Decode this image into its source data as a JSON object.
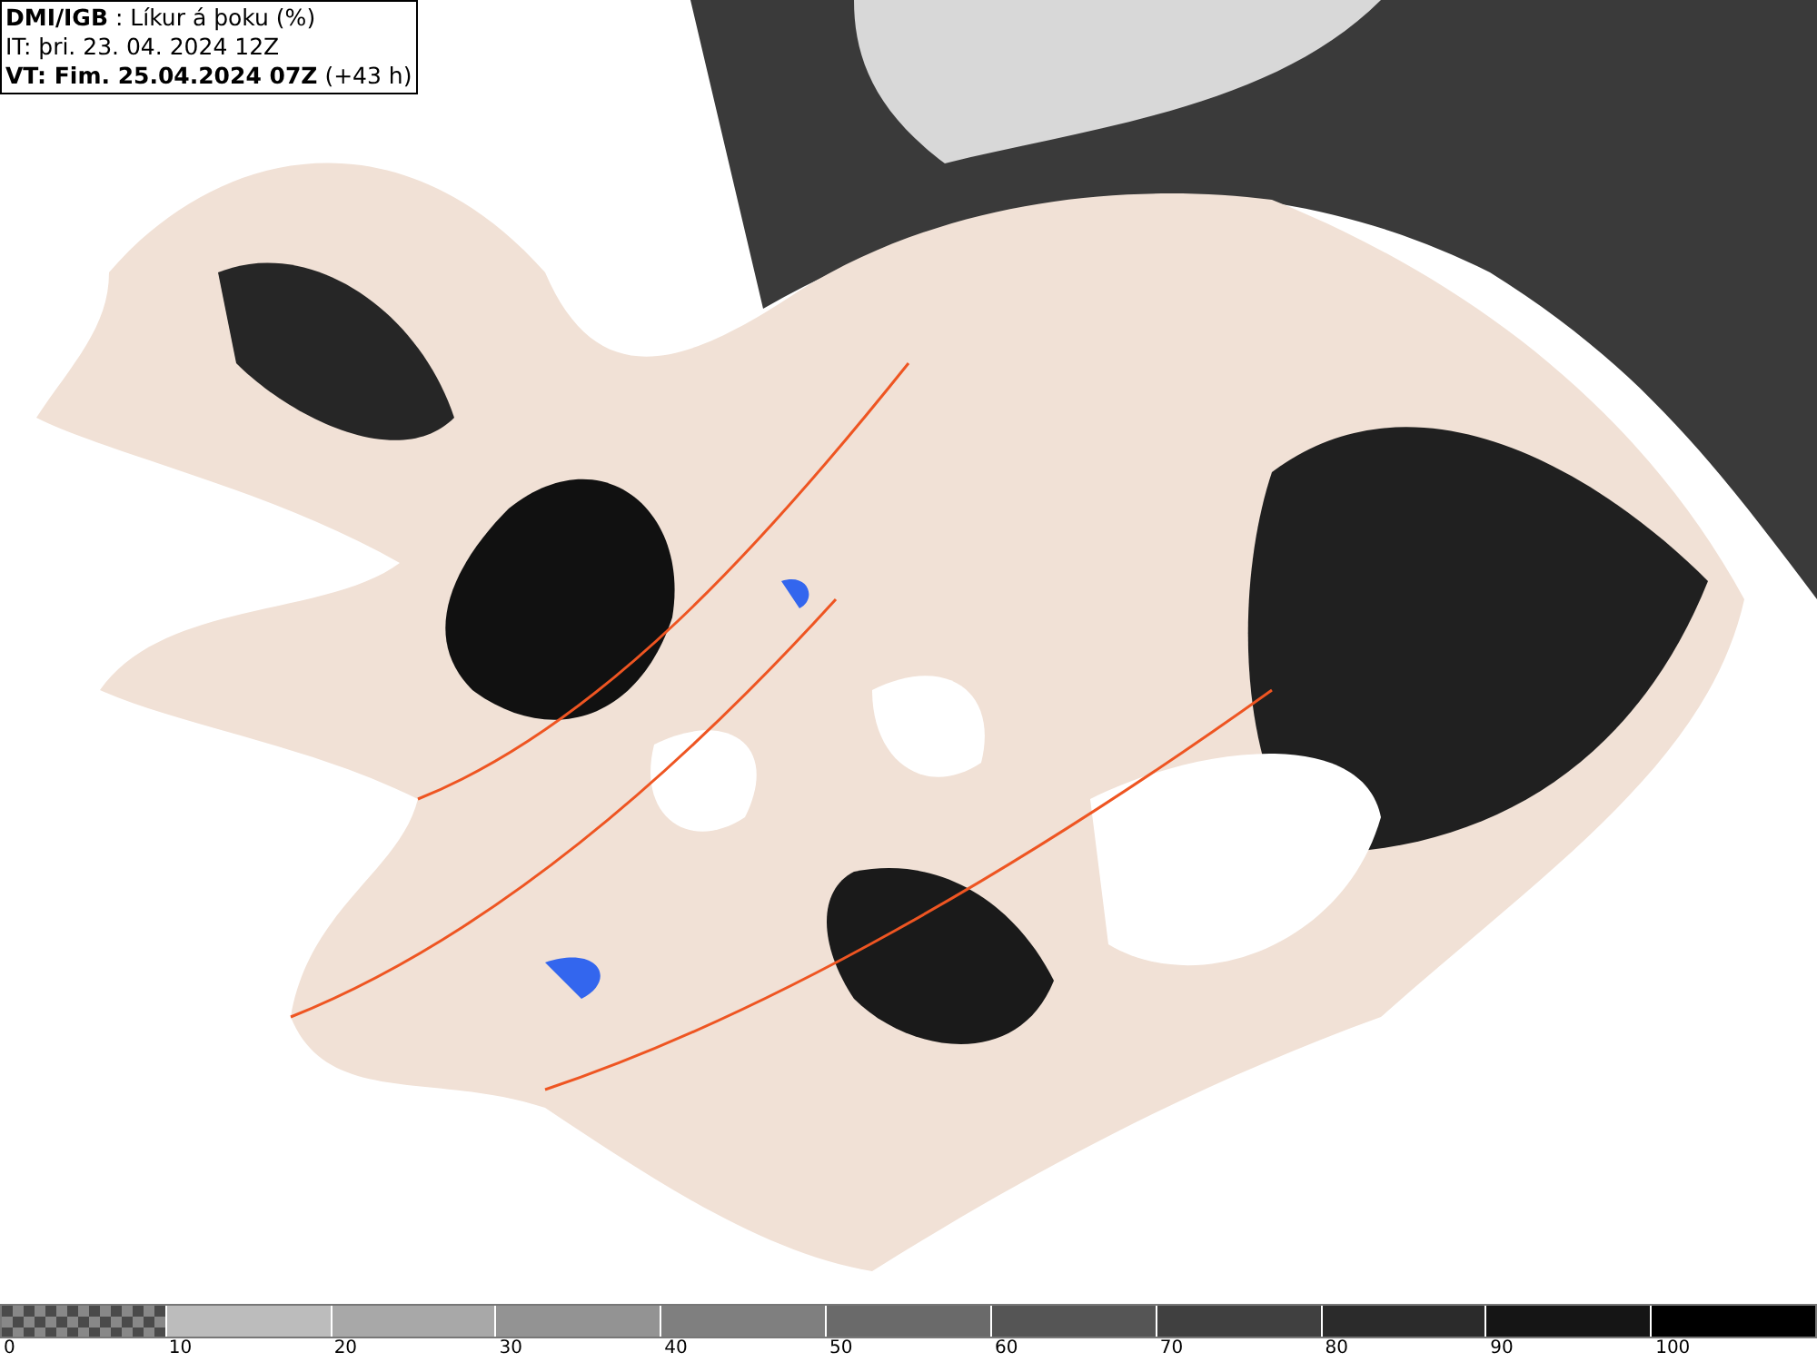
{
  "header": {
    "lines": [
      "**DMI/IGB** : Líkur á þoku (%)",
      "IT: þri. 23. 04. 2024 12Z",
      "**VT: Fim. 25.04.2024 07Z** (+43 h)"
    ]
  },
  "legend": {
    "bins": [
      {
        "kind": "checker",
        "color": "#4a4a4a"
      },
      {
        "kind": "solid",
        "color": "#bcbcbc"
      },
      {
        "kind": "solid",
        "color": "#a8a8a8"
      },
      {
        "kind": "solid",
        "color": "#939393"
      },
      {
        "kind": "solid",
        "color": "#7f7f7f"
      },
      {
        "kind": "solid",
        "color": "#6a6a6a"
      },
      {
        "kind": "solid",
        "color": "#555555"
      },
      {
        "kind": "solid",
        "color": "#404040"
      },
      {
        "kind": "solid",
        "color": "#2b2b2b"
      },
      {
        "kind": "solid",
        "color": "#151515"
      },
      {
        "kind": "solid",
        "color": "#000000"
      }
    ],
    "labels": [
      "0",
      "10",
      "20",
      "30",
      "40",
      "50",
      "60",
      "70",
      "80",
      "90",
      "100"
    ]
  }
}
